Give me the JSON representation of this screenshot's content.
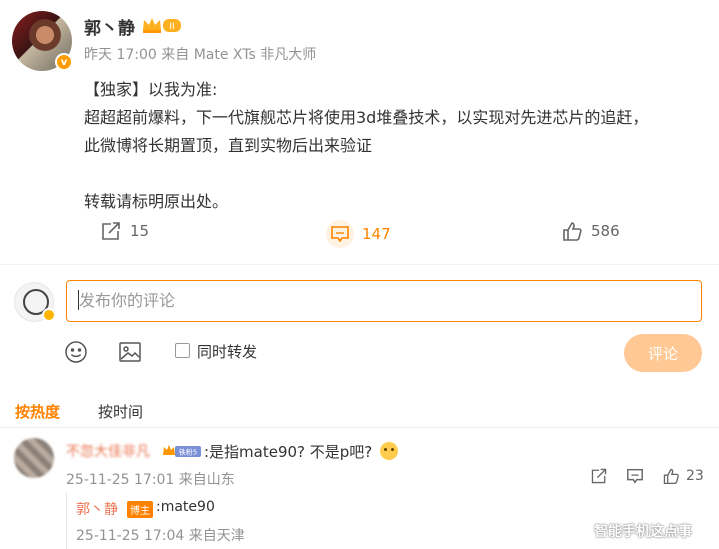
{
  "post": {
    "author": "郭丶静",
    "vip_badge": "II",
    "meta": "昨天 17:00 来自 Mate XTs 非凡大师",
    "content_lines": [
      "【独家】以我为准:",
      "超超超前爆料，下一代旗舰芯片将使用3d堆叠技术，以实现对先进芯片的追赶，",
      "此微博将长期置顶，直到实物后出来验证",
      "转载请标明原出处。"
    ],
    "actions": {
      "repost_count": "15",
      "comment_count": "147",
      "like_count": "586"
    }
  },
  "composer": {
    "placeholder": "发布你的评论",
    "also_repost_label": "同时转发",
    "submit_label": "评论"
  },
  "tabs": {
    "hot": "按热度",
    "time": "按时间"
  },
  "comments": [
    {
      "user": "不忽大佳非凡",
      "fan_badge": "铁粉5",
      "text": ":是指mate90? 不是p吧?",
      "meta": "25-11-25 17:01 来自山东",
      "like_count": "23",
      "reply": {
        "user": "郭丶静",
        "tag": "博主",
        "text": ":mate90",
        "meta": "25-11-25 17:04 来自天津"
      }
    }
  ],
  "watermark": "智能手机这点事",
  "colors": {
    "accent": "#ff8200",
    "name": "#eb7350",
    "muted": "#939393",
    "submit_disabled": "#ffc894"
  }
}
